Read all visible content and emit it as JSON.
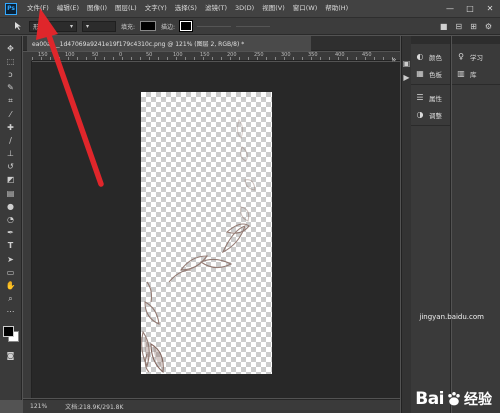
{
  "app": {
    "logo": "Ps"
  },
  "menu": [
    "文件(F)",
    "编辑(E)",
    "图像(I)",
    "图层(L)",
    "文字(Y)",
    "选择(S)",
    "滤镜(T)",
    "3D(D)",
    "视图(V)",
    "窗口(W)",
    "帮助(H)"
  ],
  "window_controls": {
    "minimize": "—",
    "maximize": "□",
    "close": "✕"
  },
  "options": {
    "mode_value": "形状",
    "fill_label": "填充:",
    "stroke_label": "描边:"
  },
  "document": {
    "tab_title": "ea00a___1d47069a9241e19f179c4310c.png @ 121% (图层 2, RGB/8) *"
  },
  "ruler": {
    "labels": [
      "150",
      "100",
      "50",
      "0",
      "50",
      "100",
      "150",
      "200",
      "250",
      "300",
      "350",
      "400",
      "450"
    ]
  },
  "status": {
    "zoom": "121%",
    "doc_info": "文档:218.9K/291.8K"
  },
  "panels": {
    "col1": [
      {
        "icon": "color-wheel-icon",
        "label": "颜色"
      },
      {
        "icon": "swatches-icon",
        "label": "色板"
      },
      {
        "icon": "properties-icon",
        "label": "属性"
      },
      {
        "icon": "adjustments-icon",
        "label": "调整"
      }
    ],
    "col2": [
      {
        "icon": "lightbulb-icon",
        "label": "学习"
      },
      {
        "icon": "library-icon",
        "label": "库"
      }
    ]
  },
  "watermark": {
    "url": "jingyan.baidu.com",
    "brand_a": "Bai",
    "brand_b": "经验"
  },
  "colors": {
    "arrow": "#e0262b",
    "canvas_bg": "#282828",
    "panel": "#3a3a3a"
  }
}
